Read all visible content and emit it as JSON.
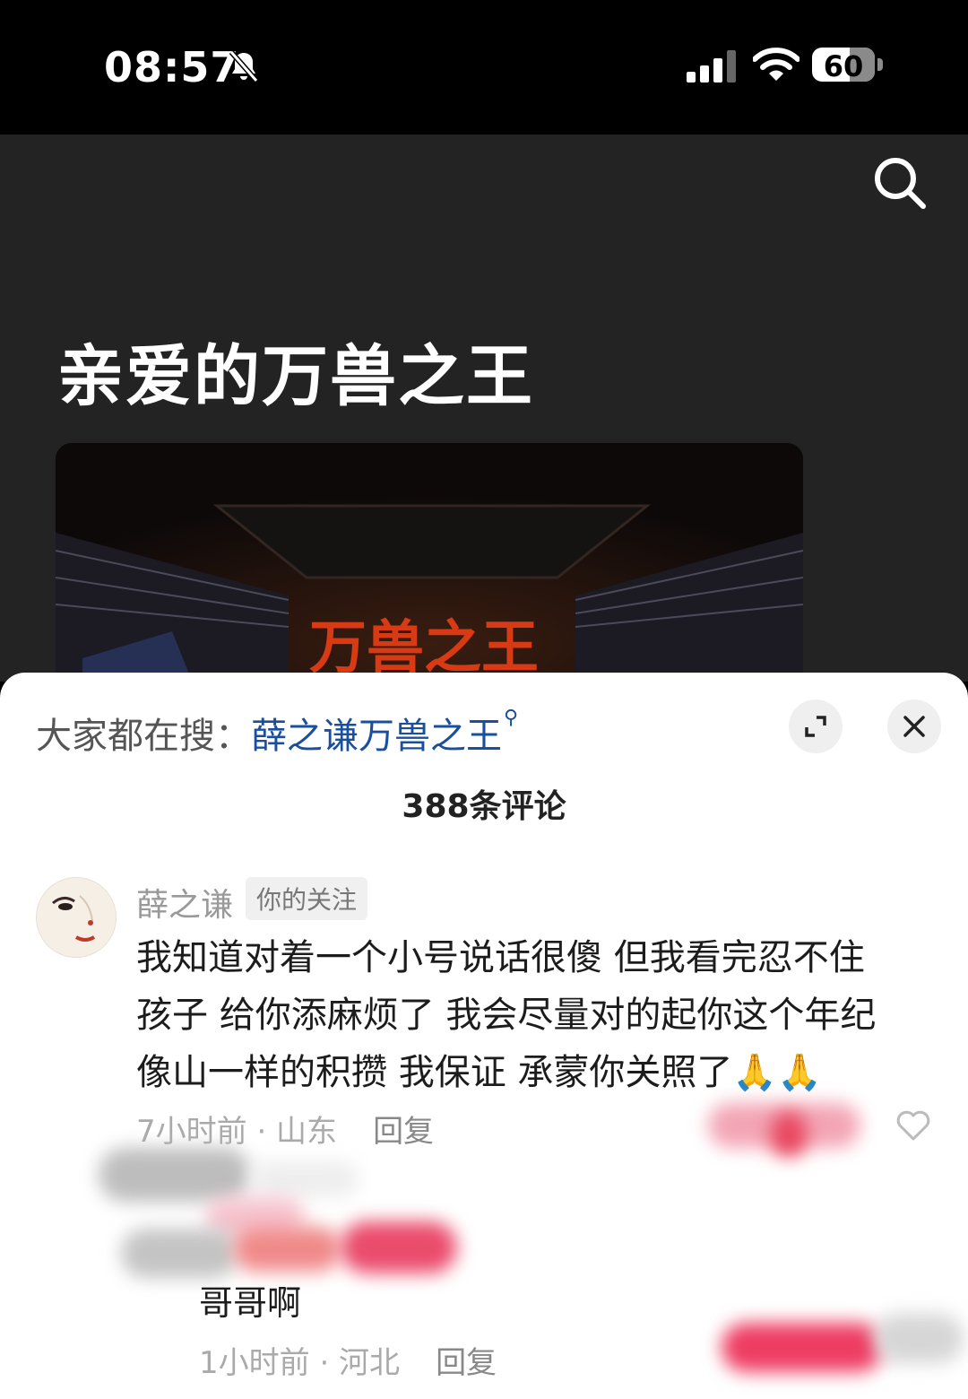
{
  "status_bar": {
    "time": "08:57",
    "battery_percent": "60",
    "battery_level": 0.6
  },
  "page": {
    "title": "亲爱的万兽之王"
  },
  "sheet": {
    "search_prefix": "大家都在搜：",
    "search_keyword": "薛之谦万兽之王",
    "comment_count": "388条评论"
  },
  "comment": {
    "username": "薛之谦",
    "tag": "你的关注",
    "lines": [
      "我知道对着一个小号说话很傻 但我看完忍不住",
      "孩子 给你添麻烦了 我会尽量对的起你这个年纪",
      "像山一样的积攒 我保证 承蒙你关照了🙏🙏"
    ],
    "time_location": "7小时前 · 山东",
    "reply_label": "回复"
  },
  "reply": {
    "text": "哥哥啊",
    "time_location": "1小时前 · 河北",
    "reply_label": "回复"
  },
  "icons": [
    "bell-slash-icon",
    "signal-icon",
    "wifi-icon",
    "battery-icon",
    "search-icon",
    "expand-icon",
    "close-icon",
    "heart-icon"
  ]
}
